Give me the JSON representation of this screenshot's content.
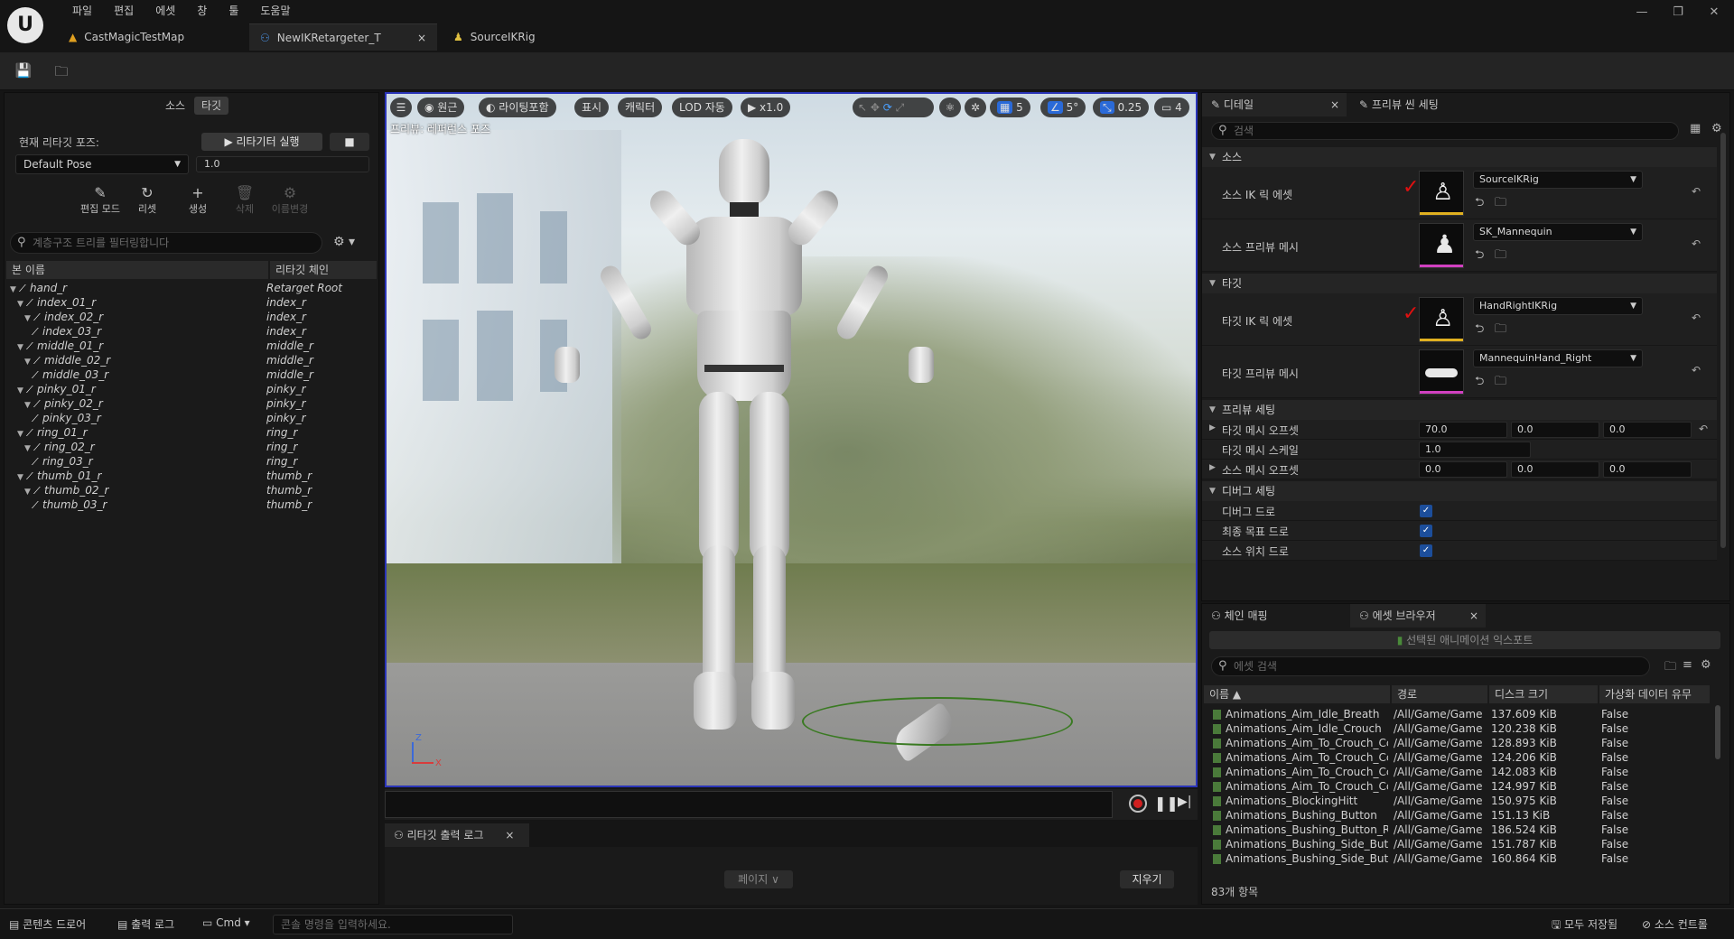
{
  "menu": [
    "파일",
    "편집",
    "에셋",
    "창",
    "툴",
    "도움말"
  ],
  "tabs": [
    {
      "label": "CastMagicTestMap"
    },
    {
      "label": "NewIKRetargeter_T",
      "close": "×"
    },
    {
      "label": "SourceIKRig"
    }
  ],
  "left": {
    "seg_source": "소스",
    "seg_target": "타깃",
    "pose_label": "현재 리타깃 포즈:",
    "run_button": "▶  리타기터 실행",
    "pose_value": "Default Pose",
    "blend_value": "1.0",
    "tools": [
      {
        "label": "편집 모드",
        "icon": "✎",
        "disabled": false
      },
      {
        "label": "리셋",
        "icon": "↻",
        "disabled": false
      },
      {
        "label": "생성",
        "icon": "+",
        "disabled": false
      },
      {
        "label": "삭제",
        "icon": "🗑",
        "disabled": true
      },
      {
        "label": "이름변경",
        "icon": "⚙",
        "disabled": true
      }
    ],
    "search_placeholder": "계층구조 트리를 필터링합니다",
    "col_bone": "본 이름",
    "col_chain": "리타깃 체인",
    "rows": [
      {
        "bone": "hand_r",
        "chain": "Retarget Root",
        "depth": 0
      },
      {
        "bone": "index_01_r",
        "chain": "index_r",
        "depth": 1
      },
      {
        "bone": "index_02_r",
        "chain": "index_r",
        "depth": 2
      },
      {
        "bone": "index_03_r",
        "chain": "index_r",
        "depth": 3
      },
      {
        "bone": "middle_01_r",
        "chain": "middle_r",
        "depth": 1
      },
      {
        "bone": "middle_02_r",
        "chain": "middle_r",
        "depth": 2
      },
      {
        "bone": "middle_03_r",
        "chain": "middle_r",
        "depth": 3
      },
      {
        "bone": "pinky_01_r",
        "chain": "pinky_r",
        "depth": 1
      },
      {
        "bone": "pinky_02_r",
        "chain": "pinky_r",
        "depth": 2
      },
      {
        "bone": "pinky_03_r",
        "chain": "pinky_r",
        "depth": 3
      },
      {
        "bone": "ring_01_r",
        "chain": "ring_r",
        "depth": 1
      },
      {
        "bone": "ring_02_r",
        "chain": "ring_r",
        "depth": 2
      },
      {
        "bone": "ring_03_r",
        "chain": "ring_r",
        "depth": 3
      },
      {
        "bone": "thumb_01_r",
        "chain": "thumb_r",
        "depth": 1
      },
      {
        "bone": "thumb_02_r",
        "chain": "thumb_r",
        "depth": 2
      },
      {
        "bone": "thumb_03_r",
        "chain": "thumb_r",
        "depth": 3
      }
    ]
  },
  "viewport": {
    "buttons": {
      "menu": "☰",
      "persp": "원근",
      "lighting": "라이팅포함",
      "show": "표시",
      "character": "캐릭터",
      "lod": "LOD 자동",
      "speed": "x1.0",
      "grid": "5",
      "angle": "5°",
      "scale": "0.25",
      "cam": "4"
    },
    "label": "프리뷰: 레퍼런스 포즈",
    "axis_z": "Z",
    "axis_x": "X"
  },
  "log": {
    "tab": "리타깃 출력 로그",
    "close": "×",
    "page": "페이지 ∨",
    "clear": "지우기"
  },
  "details": {
    "tab": "디테일",
    "tab_close": "×",
    "tab2": "프리뷰 씬 세팅",
    "search_placeholder": "검색",
    "sec_source": "소스",
    "src_ik_label": "소스 IK 릭 에셋",
    "src_ik_value": "SourceIKRig",
    "src_mesh_label": "소스 프리뷰 메시",
    "src_mesh_value": "SK_Mannequin",
    "sec_target": "타깃",
    "tgt_ik_label": "타깃 IK 릭 에셋",
    "tgt_ik_value": "HandRightIKRig",
    "tgt_mesh_label": "타깃 프리뷰 메시",
    "tgt_mesh_value": "MannequinHand_Right",
    "sec_preview": "프리뷰 세팅",
    "tgt_offset_label": "타깃 메시 오프셋",
    "tgt_offset": [
      "70.0",
      "0.0",
      "0.0"
    ],
    "tgt_scale_label": "타깃 메시 스케일",
    "tgt_scale": "1.0",
    "src_offset_label": "소스 메시 오프셋",
    "src_offset": [
      "0.0",
      "0.0",
      "0.0"
    ],
    "sec_debug": "디버그 세팅",
    "debug_draw": "디버그 드로",
    "final_goal_draw": "최종 목표 드로",
    "source_loc_draw": "소스 위치 드로"
  },
  "assets": {
    "tab_chain": "체인 매핑",
    "tab_browser": "에셋 브라우저",
    "tab_close": "×",
    "export_button": "선택된 애니메이션 익스포트",
    "search_placeholder": "에셋 검색",
    "col_name": "이름 ▲",
    "col_path": "경로",
    "col_size": "디스크 크기",
    "col_virt": "가상화 데이터 유무",
    "rows": [
      {
        "name": "Animations_Aim_Idle_Breath",
        "path": "/All/Game/Game",
        "size": "137.609 KiB",
        "virt": "False"
      },
      {
        "name": "Animations_Aim_Idle_Crouch",
        "path": "/All/Game/Game",
        "size": "120.238 KiB",
        "virt": "False"
      },
      {
        "name": "Animations_Aim_To_Crouch_Cc",
        "path": "/All/Game/Game",
        "size": "128.893 KiB",
        "virt": "False"
      },
      {
        "name": "Animations_Aim_To_Crouch_Cc",
        "path": "/All/Game/Game",
        "size": "124.206 KiB",
        "virt": "False"
      },
      {
        "name": "Animations_Aim_To_Crouch_Cc",
        "path": "/All/Game/Game",
        "size": "142.083 KiB",
        "virt": "False"
      },
      {
        "name": "Animations_Aim_To_Crouch_Cc",
        "path": "/All/Game/Game",
        "size": "124.997 KiB",
        "virt": "False"
      },
      {
        "name": "Animations_BlockingHitt",
        "path": "/All/Game/Game",
        "size": "150.975 KiB",
        "virt": "False"
      },
      {
        "name": "Animations_Bushing_Button",
        "path": "/All/Game/Game",
        "size": "151.13 KiB",
        "virt": "False"
      },
      {
        "name": "Animations_Bushing_Button_Ri",
        "path": "/All/Game/Game",
        "size": "186.524 KiB",
        "virt": "False"
      },
      {
        "name": "Animations_Bushing_Side_Butt",
        "path": "/All/Game/Game",
        "size": "151.787 KiB",
        "virt": "False"
      },
      {
        "name": "Animations_Bushing_Side_Butt",
        "path": "/All/Game/Game",
        "size": "160.864 KiB",
        "virt": "False"
      }
    ],
    "count": "83개 항목"
  },
  "status": {
    "content_drawer": "콘텐츠 드로어",
    "output_log": "출력 로그",
    "cmd": "Cmd",
    "cmd_placeholder": "콘솔 명령을 입력하세요.",
    "save_all": "모두 저장됨",
    "source_control": "소스 컨트롤"
  }
}
